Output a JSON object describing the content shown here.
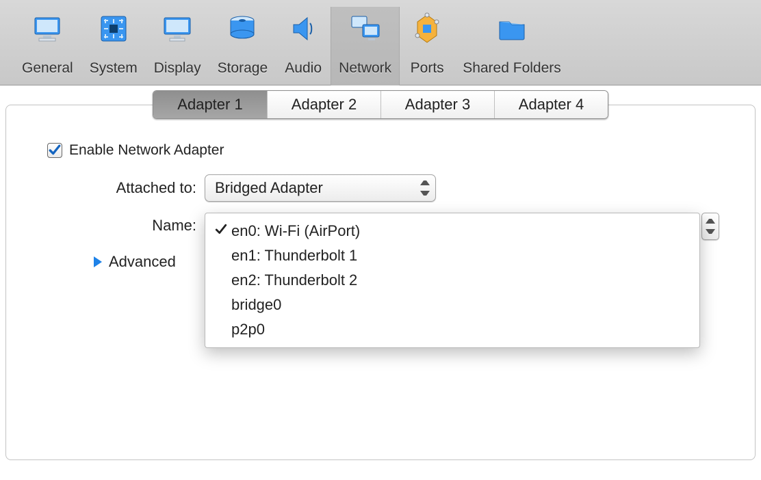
{
  "toolbar": {
    "items": [
      {
        "label": "General"
      },
      {
        "label": "System"
      },
      {
        "label": "Display"
      },
      {
        "label": "Storage"
      },
      {
        "label": "Audio"
      },
      {
        "label": "Network"
      },
      {
        "label": "Ports"
      },
      {
        "label": "Shared Folders"
      }
    ],
    "selected_index": 5
  },
  "tabs": {
    "items": [
      {
        "label": "Adapter 1"
      },
      {
        "label": "Adapter 2"
      },
      {
        "label": "Adapter 3"
      },
      {
        "label": "Adapter 4"
      }
    ],
    "selected_index": 0
  },
  "enable_adapter": {
    "label": "Enable Network Adapter",
    "checked": true
  },
  "attached_to": {
    "label": "Attached to:",
    "value": "Bridged Adapter"
  },
  "name": {
    "label": "Name:",
    "selected": "en0: Wi-Fi (AirPort)",
    "options": [
      "en0: Wi-Fi (AirPort)",
      "en1: Thunderbolt 1",
      "en2: Thunderbolt 2",
      "bridge0",
      "p2p0"
    ]
  },
  "advanced": {
    "label": "Advanced"
  }
}
